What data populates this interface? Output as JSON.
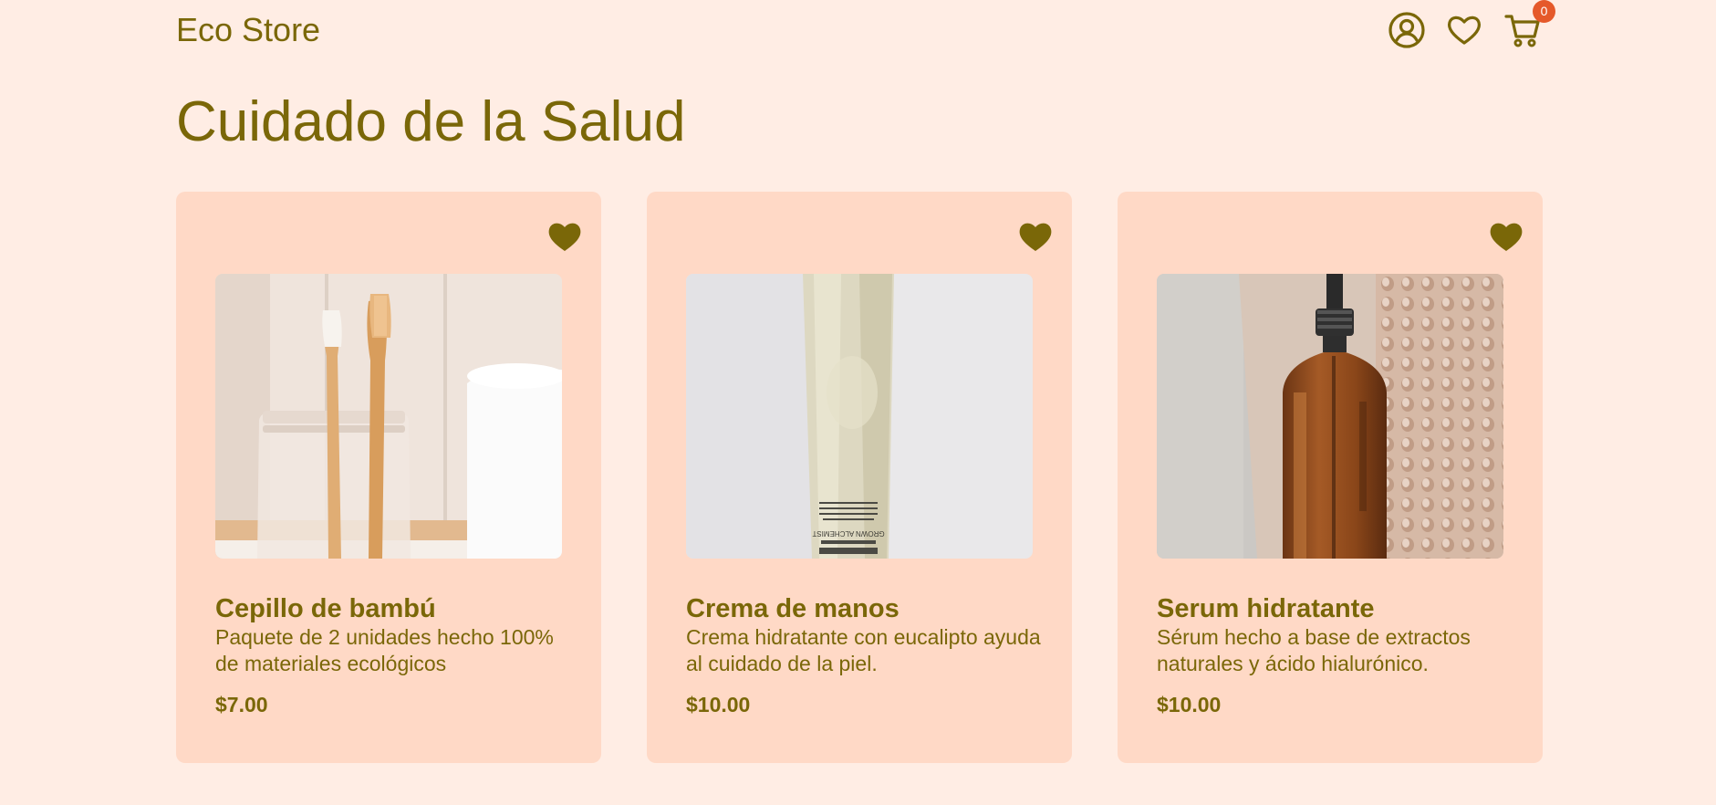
{
  "header": {
    "brand": "Eco Store",
    "icons": [
      "user-circle-icon",
      "heart-outline-icon",
      "cart-icon"
    ],
    "cart_count": "0"
  },
  "page": {
    "title": "Cuidado de la Salud"
  },
  "colors": {
    "background": "#ffede4",
    "card": "#ffd9c6",
    "accent": "#7a6708",
    "badge": "#e5592a"
  },
  "products": [
    {
      "name": "Cepillo de bambú",
      "description": "Paquete de 2 unidades hecho 100% de materiales ecológicos",
      "price": "$7.00",
      "image": "bamboo-toothbrushes-in-jar",
      "favorited": true
    },
    {
      "name": "Crema de manos",
      "description": "Crema hidratante con eucalipto ayuda al cuidado de la piel.",
      "price": "$10.00",
      "image": "hand-cream-tube",
      "tube_label": "GROWN ALCHEMIST",
      "favorited": true
    },
    {
      "name": "Serum hidratante",
      "description": "Sérum hecho a base de extractos naturales y ácido hialurónico.",
      "price": "$10.00",
      "image": "amber-serum-bottle",
      "favorited": true
    }
  ]
}
